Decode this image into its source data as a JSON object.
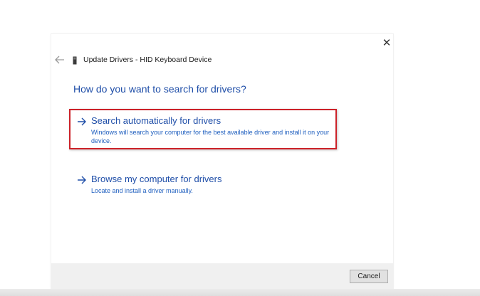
{
  "window": {
    "title": "Update Drivers - HID Keyboard Device",
    "close_glyph": "✕"
  },
  "main": {
    "heading": "How do you want to search for drivers?",
    "options": [
      {
        "title": "Search automatically for drivers",
        "description": "Windows will search your computer for the best available driver and install it on your device.",
        "icon": "arrow-right-icon",
        "highlighted": true
      },
      {
        "title": "Browse my computer for drivers",
        "description": "Locate and install a driver manually.",
        "icon": "arrow-right-icon",
        "highlighted": false
      }
    ]
  },
  "footer": {
    "cancel_label": "Cancel"
  },
  "colors": {
    "accent_blue": "#1f4ea8",
    "highlight_red": "#cc2229",
    "footer_bg": "#f0f0f0"
  },
  "icons": {
    "back": "back-arrow-icon",
    "device": "keyboard-device-icon",
    "close": "close-icon"
  }
}
